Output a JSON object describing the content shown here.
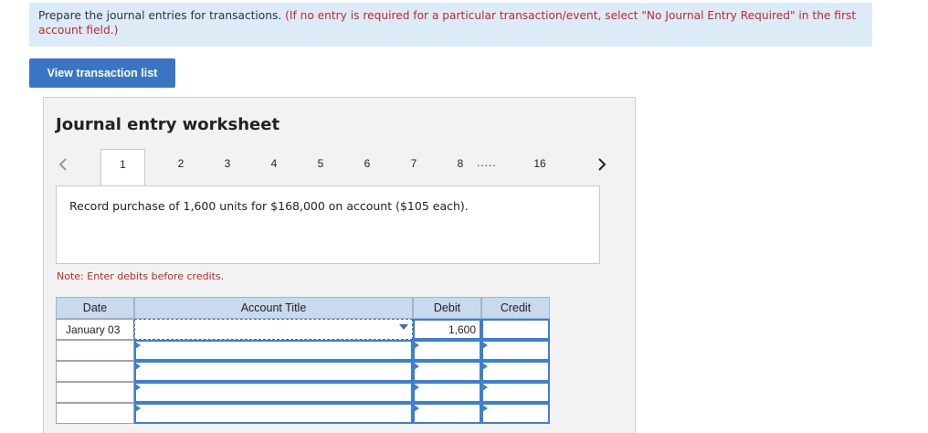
{
  "instructions": {
    "text": "Prepare the journal entries for transactions.",
    "hint": "(If no entry is required for a particular transaction/event, select \"No Journal Entry Required\" in the first account field.)"
  },
  "view_button_label": "View transaction list",
  "worksheet": {
    "title": "Journal entry worksheet",
    "tabs": [
      "1",
      "2",
      "3",
      "4",
      "5",
      "6",
      "7",
      "8"
    ],
    "active_tab": "1",
    "ellipsis": ".....",
    "last_tab": "16",
    "description": "Record purchase of 1,600 units for $168,000 on account ($105 each).",
    "note": "Note: Enter debits before credits."
  },
  "table": {
    "headers": {
      "date": "Date",
      "account": "Account Title",
      "debit": "Debit",
      "credit": "Credit"
    },
    "rows": [
      {
        "date": "January 03",
        "account": "",
        "debit": "1,600",
        "credit": ""
      },
      {
        "date": "",
        "account": "",
        "debit": "",
        "credit": ""
      },
      {
        "date": "",
        "account": "",
        "debit": "",
        "credit": ""
      },
      {
        "date": "",
        "account": "",
        "debit": "",
        "credit": ""
      },
      {
        "date": "",
        "account": "",
        "debit": "",
        "credit": ""
      }
    ]
  },
  "colors": {
    "instruction_bg": "#dcebf8",
    "hint_red": "#c0282d",
    "button_blue": "#3a75c4",
    "header_bg": "#c9d9ee",
    "input_border": "#3d7fd1"
  }
}
